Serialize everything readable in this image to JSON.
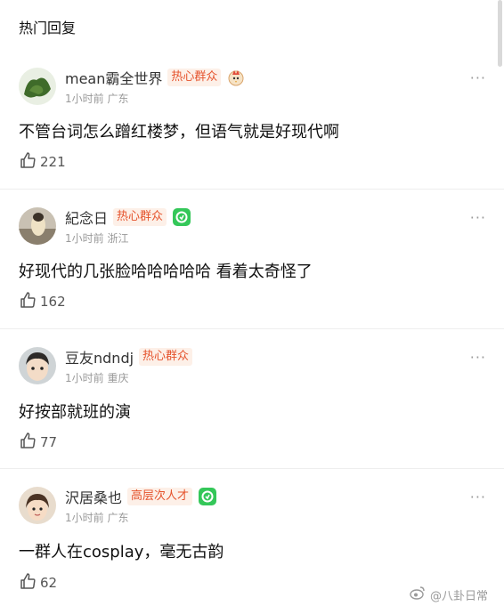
{
  "header": {
    "title": "热门回复"
  },
  "comments": [
    {
      "username": "mean霸全世界",
      "badge": "热心群众",
      "meta": "1小时前 广东",
      "text": "不管台词怎么蹭红楼梦，但语气就是好现代啊",
      "likes": "221"
    },
    {
      "username": "紀念日",
      "badge": "热心群众",
      "meta": "1小时前 浙江",
      "text": "好现代的几张脸哈哈哈哈哈 看着太奇怪了",
      "likes": "162"
    },
    {
      "username": "豆友ndndj",
      "badge": "热心群众",
      "meta": "1小时前 重庆",
      "text": "好按部就班的演",
      "likes": "77"
    },
    {
      "username": "沢居桑也",
      "badge": "高层次人才",
      "meta": "1小时前 广东",
      "text": "一群人在cosplay，毫无古韵",
      "likes": "62"
    }
  ],
  "more_label": "···",
  "watermark": {
    "text": "@八卦日常"
  },
  "colors": {
    "badge_text": "#e5532d",
    "badge_bg": "#fdf0e8",
    "green_badge": "#34c759"
  }
}
